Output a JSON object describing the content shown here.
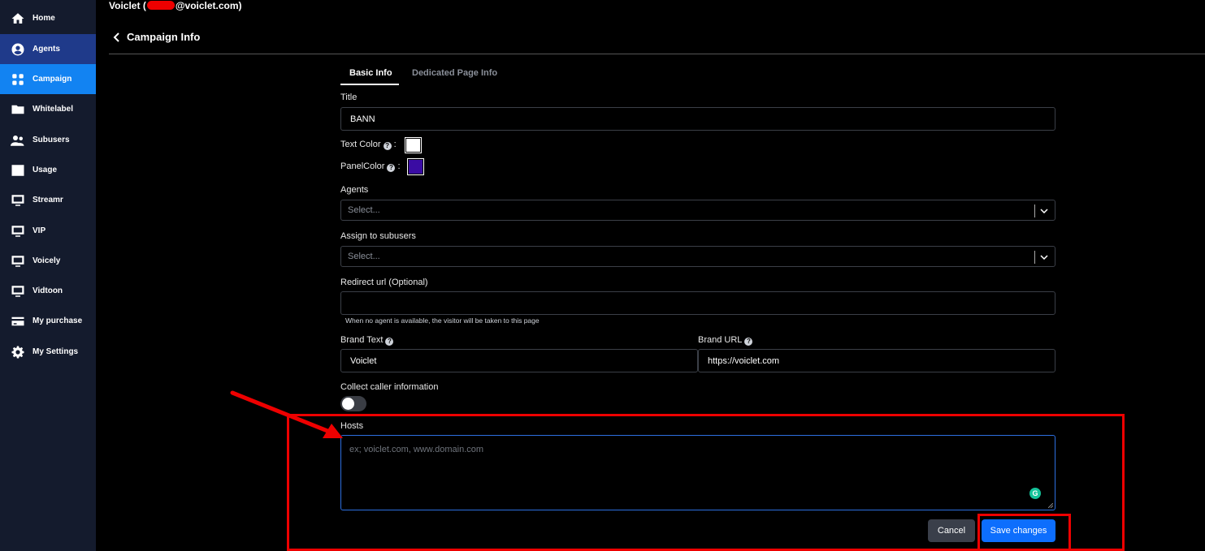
{
  "account": {
    "name": "Voiclet",
    "paren_open": "(",
    "email_suffix": "@voiclet.com)"
  },
  "sidebar": {
    "items": [
      {
        "label": "Home",
        "icon": "home-icon"
      },
      {
        "label": "Agents",
        "icon": "user-circle-icon"
      },
      {
        "label": "Campaign",
        "icon": "grid-icon"
      },
      {
        "label": "Whitelabel",
        "icon": "folder-icon"
      },
      {
        "label": "Subusers",
        "icon": "users-icon"
      },
      {
        "label": "Usage",
        "icon": "chart-icon"
      },
      {
        "label": "Streamr",
        "icon": "monitor-icon"
      },
      {
        "label": "VIP",
        "icon": "monitor-icon"
      },
      {
        "label": "Voicely",
        "icon": "monitor-icon"
      },
      {
        "label": "Vidtoon",
        "icon": "monitor-icon"
      },
      {
        "label": "My purchase",
        "icon": "credit-card-icon"
      },
      {
        "label": "My Settings",
        "icon": "gear-icon"
      }
    ]
  },
  "page": {
    "title": "Campaign Info"
  },
  "tabs": [
    {
      "label": "Basic Info",
      "active": true
    },
    {
      "label": "Dedicated Page Info",
      "active": false
    }
  ],
  "form": {
    "title": {
      "label": "Title",
      "value": "BANN"
    },
    "text_color": {
      "label": "Text Color",
      "sep": ":",
      "value": "#ffffff"
    },
    "panel_color": {
      "label": "PanelColor",
      "sep": ":",
      "value": "#3a0ca3"
    },
    "agents": {
      "label": "Agents",
      "placeholder": "Select..."
    },
    "subusers": {
      "label": "Assign to subusers",
      "placeholder": "Select..."
    },
    "redirect": {
      "label": "Redirect url (Optional)",
      "value": "",
      "hint": "When no agent is available, the visitor will be taken to this page"
    },
    "brand_text": {
      "label": "Brand Text",
      "value": "Voiclet"
    },
    "brand_url": {
      "label": "Brand URL",
      "value": "https://voiclet.com"
    },
    "collect": {
      "label": "Collect caller information",
      "enabled": false
    },
    "hosts": {
      "label": "Hosts",
      "placeholder": "ex; voiclet.com, www.domain.com"
    }
  },
  "buttons": {
    "cancel": "Cancel",
    "save": "Save changes"
  },
  "colors": {
    "active_nav": "#1283f2",
    "primary": "#0d6efd",
    "annotation": "#ee0000"
  }
}
